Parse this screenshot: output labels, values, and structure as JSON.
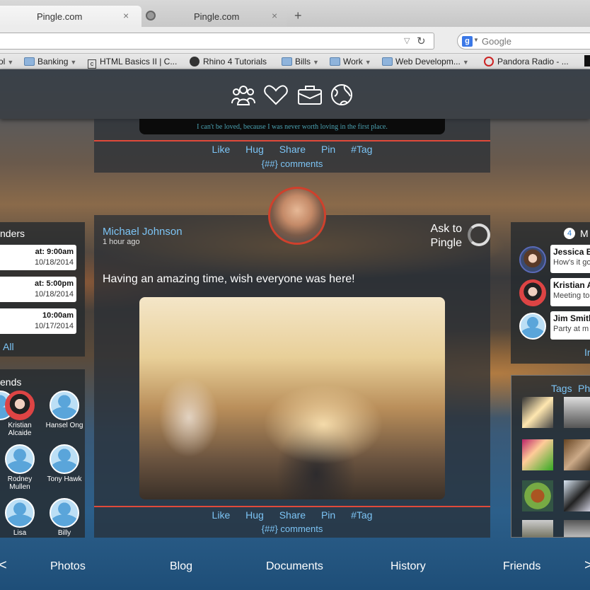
{
  "browser": {
    "tabs": [
      {
        "title": "Pingle.com",
        "close": "×"
      },
      {
        "title": "Pingle.com",
        "close": "×"
      }
    ],
    "new_tab": "+",
    "search_placeholder": "Google",
    "search_engine_letter": "g",
    "bookmarks": [
      {
        "label": "ol",
        "arrow": "▼"
      },
      {
        "label": "Banking",
        "arrow": "▼"
      },
      {
        "label": "HTML Basics II | C..."
      },
      {
        "label": "Rhino 4 Tutorials"
      },
      {
        "label": "Bills",
        "arrow": "▼"
      },
      {
        "label": "Work",
        "arrow": "▼"
      },
      {
        "label": "Web Developm...",
        "arrow": "▼"
      },
      {
        "label": "Pandora Radio - ..."
      }
    ]
  },
  "top_nav": {
    "icons": [
      "people-icon",
      "heart-icon",
      "briefcase-icon",
      "globe-icon"
    ]
  },
  "top_post": {
    "quote": "I can't be loved, because I was never worth loving in the first place.",
    "actions": [
      "Like",
      "Hug",
      "Share",
      "Pin",
      "#Tag"
    ],
    "comments": "{##} comments"
  },
  "main_post": {
    "author": "Michael Johnson",
    "time": "1 hour ago",
    "ask_label": "Ask to Pingle",
    "status": "Having an amazing time, wish everyone was here!",
    "actions": [
      "Like",
      "Hug",
      "Share",
      "Pin",
      "#Tag"
    ],
    "comments": "{##} comments"
  },
  "reminders": {
    "title": "nders",
    "items": [
      {
        "time": "at: 9:00am",
        "date": "10/18/2014"
      },
      {
        "time": "at: 5:00pm",
        "date": "10/18/2014"
      },
      {
        "time": "10:00am",
        "date": "10/17/2014"
      }
    ],
    "view_all": "All"
  },
  "friends": {
    "title": "ends",
    "items": [
      {
        "name": "",
        "photo": false
      },
      {
        "name": "Kristian Alcaide",
        "photo": true
      },
      {
        "name": "Hansel Ong",
        "photo": false
      },
      {
        "name": "",
        "photo": false
      },
      {
        "name": "Rodney Mullen",
        "photo": false
      },
      {
        "name": "Tony Hawk",
        "photo": false
      },
      {
        "name": "",
        "photo": false
      },
      {
        "name": "Lisa",
        "photo": false
      },
      {
        "name": "Billy",
        "photo": false
      }
    ]
  },
  "messages": {
    "count": "4",
    "title": "M",
    "items": [
      {
        "name": "Jessica B",
        "preview": "How's it go"
      },
      {
        "name": "Kristian A",
        "preview": "Meeting to"
      },
      {
        "name": "Jim Smith",
        "preview": "Party at m"
      }
    ],
    "more": "In"
  },
  "photos_panel": {
    "tabs": [
      "Tags",
      "Ph"
    ]
  },
  "bottom_nav": {
    "prev": "<",
    "items": [
      "Photos",
      "Blog",
      "Documents",
      "History",
      "Friends"
    ],
    "next": ">"
  },
  "colors": {
    "accent": "#7cc4f5",
    "divider": "#e04a3a"
  }
}
